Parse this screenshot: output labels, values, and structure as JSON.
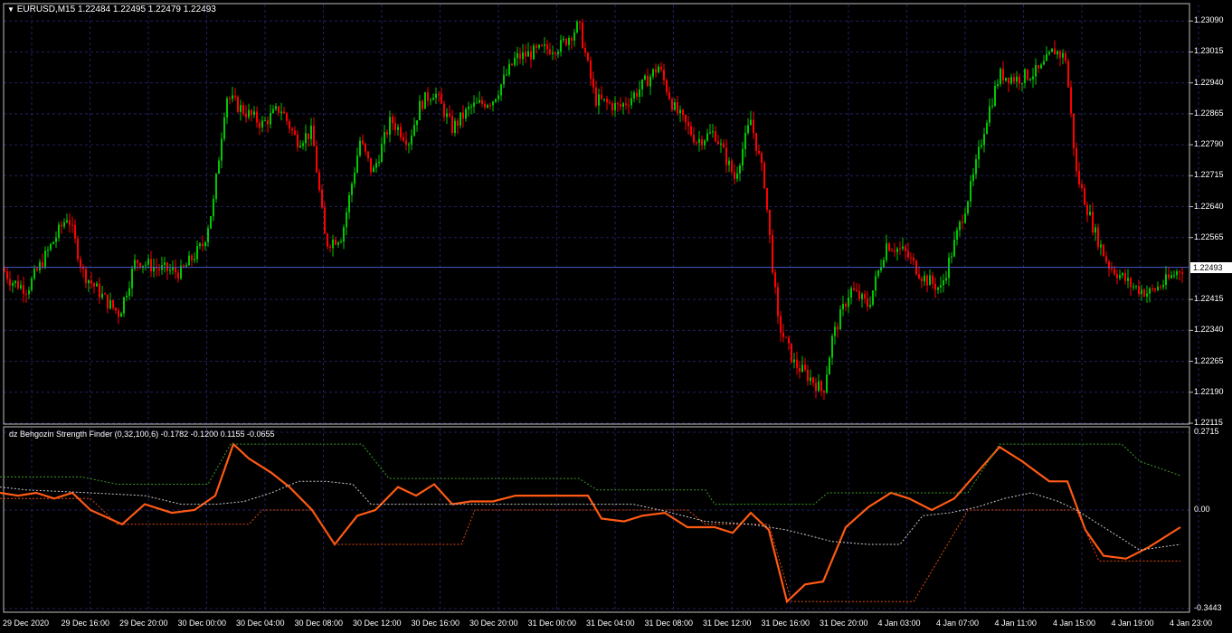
{
  "main": {
    "symbol_header": "EURUSD,M15  1.22484 1.22495 1.22479 1.22493",
    "current_price": "1.22493",
    "y_ticks": [
      "1.23090",
      "1.23015",
      "1.22940",
      "1.22865",
      "1.22790",
      "1.22715",
      "1.22640",
      "1.22565",
      "1.22415",
      "1.22340",
      "1.22265",
      "1.22190",
      "1.22115"
    ],
    "colors": {
      "bull": "#00c800",
      "bear": "#ff0000",
      "grid": "#202060",
      "bg": "#000000"
    }
  },
  "indicator": {
    "header": "dz Behgozin Strength Finder (0,32,100,6) -0.1782 -0.1200 0.1155 -0.0655",
    "y_ticks": [
      "0.2715",
      "0.00",
      "-0.3443"
    ],
    "colors": {
      "main": "#ff5a14",
      "upper": "#3c9a28",
      "lower": "#e04a10",
      "mid": "#c8c8c8"
    }
  },
  "x_ticks": [
    "29 Dec 2020",
    "29 Dec 16:00",
    "29 Dec 20:00",
    "30 Dec 00:00",
    "30 Dec 04:00",
    "30 Dec 08:00",
    "30 Dec 12:00",
    "30 Dec 16:00",
    "30 Dec 20:00",
    "31 Dec 00:00",
    "31 Dec 04:00",
    "31 Dec 08:00",
    "31 Dec 12:00",
    "31 Dec 16:00",
    "31 Dec 20:00",
    "4 Jan 03:00",
    "4 Jan 07:00",
    "4 Jan 11:00",
    "4 Jan 15:00",
    "4 Jan 19:00",
    "4 Jan 23:00"
  ],
  "chart_data": [
    {
      "type": "candlestick",
      "title": "EURUSD,M15",
      "ylim": [
        1.22115,
        1.2313
      ],
      "x": [
        "29 Dec 2020",
        "29 Dec 16:00",
        "29 Dec 20:00",
        "30 Dec 00:00",
        "30 Dec 04:00",
        "30 Dec 08:00",
        "30 Dec 12:00",
        "30 Dec 16:00",
        "30 Dec 20:00",
        "31 Dec 00:00",
        "31 Dec 04:00",
        "31 Dec 08:00",
        "31 Dec 12:00",
        "31 Dec 16:00",
        "31 Dec 20:00",
        "4 Jan 03:00",
        "4 Jan 07:00",
        "4 Jan 11:00",
        "4 Jan 15:00",
        "4 Jan 19:00",
        "4 Jan 23:00"
      ],
      "close": [
        1.2248,
        1.2242,
        1.2247,
        1.226,
        1.2288,
        1.2262,
        1.2276,
        1.229,
        1.2288,
        1.2304,
        1.2286,
        1.228,
        1.227,
        1.2228,
        1.2233,
        1.2254,
        1.2244,
        1.2293,
        1.229,
        1.2245,
        1.22493
      ],
      "anchors": [
        [
          0,
          1.225
        ],
        [
          12,
          1.2246
        ],
        [
          30,
          1.2244
        ],
        [
          50,
          1.2252
        ],
        [
          75,
          1.2262
        ],
        [
          92,
          1.2248
        ],
        [
          118,
          1.2241
        ],
        [
          132,
          1.2238
        ],
        [
          150,
          1.2251
        ],
        [
          175,
          1.2249
        ],
        [
          200,
          1.2248
        ],
        [
          225,
          1.2255
        ],
        [
          236,
          1.2265
        ],
        [
          250,
          1.2291
        ],
        [
          265,
          1.2288
        ],
        [
          290,
          1.2284
        ],
        [
          310,
          1.2288
        ],
        [
          328,
          1.228
        ],
        [
          345,
          1.2282
        ],
        [
          360,
          1.2255
        ],
        [
          378,
          1.2257
        ],
        [
          398,
          1.228
        ],
        [
          412,
          1.2272
        ],
        [
          432,
          1.2285
        ],
        [
          452,
          1.228
        ],
        [
          465,
          1.2289
        ],
        [
          480,
          1.2292
        ],
        [
          500,
          1.2283
        ],
        [
          520,
          1.2288
        ],
        [
          545,
          1.229
        ],
        [
          570,
          1.23
        ],
        [
          600,
          1.2302
        ],
        [
          620,
          1.2303
        ],
        [
          640,
          1.2308
        ],
        [
          658,
          1.229
        ],
        [
          685,
          1.2288
        ],
        [
          705,
          1.2292
        ],
        [
          728,
          1.2298
        ],
        [
          745,
          1.2288
        ],
        [
          770,
          1.228
        ],
        [
          790,
          1.2282
        ],
        [
          812,
          1.2271
        ],
        [
          830,
          1.2285
        ],
        [
          845,
          1.227
        ],
        [
          860,
          1.2236
        ],
        [
          878,
          1.2226
        ],
        [
          898,
          1.2222
        ],
        [
          910,
          1.2219
        ],
        [
          920,
          1.2232
        ],
        [
          940,
          1.2244
        ],
        [
          960,
          1.224
        ],
        [
          980,
          1.2255
        ],
        [
          1000,
          1.2253
        ],
        [
          1020,
          1.2247
        ],
        [
          1040,
          1.2244
        ],
        [
          1055,
          1.2255
        ],
        [
          1075,
          1.227
        ],
        [
          1090,
          1.2285
        ],
        [
          1105,
          1.2296
        ],
        [
          1125,
          1.2295
        ],
        [
          1150,
          1.2297
        ],
        [
          1165,
          1.2302
        ],
        [
          1178,
          1.23
        ],
        [
          1190,
          1.2272
        ],
        [
          1210,
          1.2258
        ],
        [
          1225,
          1.225
        ],
        [
          1250,
          1.2245
        ],
        [
          1270,
          1.2243
        ],
        [
          1290,
          1.2246
        ],
        [
          1305,
          1.2249
        ]
      ]
    },
    {
      "type": "line",
      "title": "dz Behgozin Strength Finder (0,32,100,6)",
      "ylim": [
        -0.3443,
        0.2715
      ],
      "series": [
        {
          "role": "main",
          "points": [
            [
              0,
              0.06
            ],
            [
              20,
              0.05
            ],
            [
              40,
              0.06
            ],
            [
              60,
              0.04
            ],
            [
              80,
              0.06
            ],
            [
              100,
              0.0
            ],
            [
              135,
              -0.05
            ],
            [
              160,
              0.02
            ],
            [
              190,
              -0.01
            ],
            [
              215,
              0.0
            ],
            [
              238,
              0.05
            ],
            [
              258,
              0.23
            ],
            [
              275,
              0.18
            ],
            [
              300,
              0.13
            ],
            [
              320,
              0.08
            ],
            [
              345,
              0.0
            ],
            [
              370,
              -0.12
            ],
            [
              395,
              -0.02
            ],
            [
              415,
              0.0
            ],
            [
              440,
              0.08
            ],
            [
              460,
              0.05
            ],
            [
              480,
              0.09
            ],
            [
              500,
              0.02
            ],
            [
              520,
              0.03
            ],
            [
              545,
              0.03
            ],
            [
              570,
              0.05
            ],
            [
              600,
              0.05
            ],
            [
              630,
              0.05
            ],
            [
              650,
              0.05
            ],
            [
              665,
              -0.03
            ],
            [
              690,
              -0.04
            ],
            [
              710,
              -0.02
            ],
            [
              735,
              -0.01
            ],
            [
              760,
              -0.06
            ],
            [
              790,
              -0.06
            ],
            [
              810,
              -0.08
            ],
            [
              830,
              -0.01
            ],
            [
              850,
              -0.07
            ],
            [
              870,
              -0.32
            ],
            [
              890,
              -0.26
            ],
            [
              910,
              -0.25
            ],
            [
              935,
              -0.06
            ],
            [
              960,
              0.01
            ],
            [
              985,
              0.06
            ],
            [
              1005,
              0.04
            ],
            [
              1030,
              0.0
            ],
            [
              1055,
              0.04
            ],
            [
              1080,
              0.13
            ],
            [
              1105,
              0.22
            ],
            [
              1130,
              0.17
            ],
            [
              1160,
              0.1
            ],
            [
              1180,
              0.1
            ],
            [
              1200,
              -0.07
            ],
            [
              1220,
              -0.16
            ],
            [
              1245,
              -0.17
            ],
            [
              1270,
              -0.13
            ],
            [
              1305,
              -0.06
            ]
          ]
        },
        {
          "role": "upper",
          "points": [
            [
              0,
              0.1155
            ],
            [
              25,
              0.1155
            ],
            [
              90,
              0.1155
            ],
            [
              130,
              0.09
            ],
            [
              230,
              0.09
            ],
            [
              255,
              0.23
            ],
            [
              400,
              0.23
            ],
            [
              430,
              0.11
            ],
            [
              640,
              0.11
            ],
            [
              660,
              0.07
            ],
            [
              780,
              0.07
            ],
            [
              790,
              0.02
            ],
            [
              900,
              0.02
            ],
            [
              915,
              0.06
            ],
            [
              1070,
              0.06
            ],
            [
              1105,
              0.23
            ],
            [
              1240,
              0.23
            ],
            [
              1260,
              0.17
            ],
            [
              1305,
              0.12
            ]
          ]
        },
        {
          "role": "lower",
          "points": [
            [
              0,
              0.04
            ],
            [
              100,
              0.04
            ],
            [
              130,
              -0.05
            ],
            [
              275,
              -0.05
            ],
            [
              290,
              0.0
            ],
            [
              345,
              0.0
            ],
            [
              370,
              -0.12
            ],
            [
              510,
              -0.12
            ],
            [
              525,
              0.0
            ],
            [
              650,
              0.0
            ],
            [
              660,
              0.0
            ],
            [
              760,
              0.0
            ],
            [
              780,
              -0.05
            ],
            [
              850,
              -0.05
            ],
            [
              875,
              -0.32
            ],
            [
              1010,
              -0.32
            ],
            [
              1070,
              0.0
            ],
            [
              1190,
              0.0
            ],
            [
              1215,
              -0.1782
            ],
            [
              1305,
              -0.1782
            ]
          ]
        },
        {
          "role": "mid",
          "points": [
            [
              0,
              0.08
            ],
            [
              30,
              0.07
            ],
            [
              100,
              0.06
            ],
            [
              160,
              0.05
            ],
            [
              200,
              0.02
            ],
            [
              240,
              0.02
            ],
            [
              270,
              0.03
            ],
            [
              300,
              0.06
            ],
            [
              330,
              0.1
            ],
            [
              360,
              0.1
            ],
            [
              390,
              0.09
            ],
            [
              410,
              0.02
            ],
            [
              480,
              0.02
            ],
            [
              560,
              0.02
            ],
            [
              640,
              0.02
            ],
            [
              700,
              0.02
            ],
            [
              730,
              0.0
            ],
            [
              780,
              -0.04
            ],
            [
              830,
              -0.05
            ],
            [
              870,
              -0.07
            ],
            [
              920,
              -0.11
            ],
            [
              960,
              -0.12
            ],
            [
              995,
              -0.12
            ],
            [
              1020,
              -0.02
            ],
            [
              1050,
              -0.01
            ],
            [
              1080,
              0.01
            ],
            [
              1110,
              0.04
            ],
            [
              1140,
              0.06
            ],
            [
              1170,
              0.03
            ],
            [
              1190,
              0.0
            ],
            [
              1230,
              -0.08
            ],
            [
              1260,
              -0.14
            ],
            [
              1305,
              -0.12
            ]
          ]
        }
      ]
    }
  ]
}
